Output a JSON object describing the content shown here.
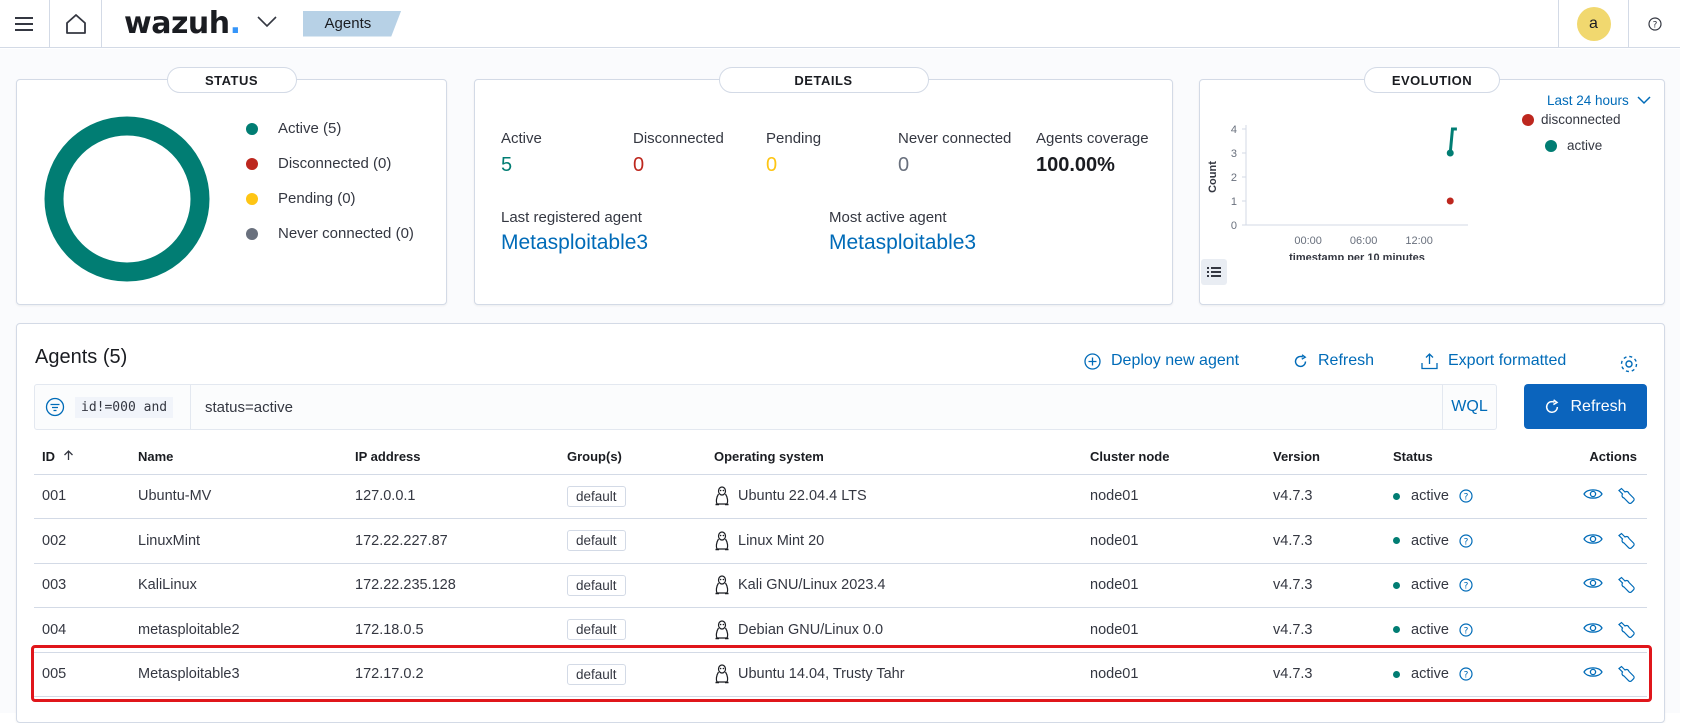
{
  "header": {
    "logo_text": "wazuh",
    "logo_dot": ".",
    "breadcrumb": "Agents",
    "avatar_letter": "a"
  },
  "status_panel": {
    "title": "STATUS",
    "legend": [
      {
        "label": "Active (5)",
        "color": "#017d73"
      },
      {
        "label": "Disconnected (0)",
        "color": "#bd271e"
      },
      {
        "label": "Pending (0)",
        "color": "#fec514"
      },
      {
        "label": "Never connected (0)",
        "color": "#69707d"
      }
    ],
    "donut_color": "#017d73"
  },
  "details_panel": {
    "title": "DETAILS",
    "stats": [
      {
        "label": "Active",
        "value": "5",
        "color": "#017d73"
      },
      {
        "label": "Disconnected",
        "value": "0",
        "color": "#bd271e"
      },
      {
        "label": "Pending",
        "value": "0",
        "color": "#fec514"
      },
      {
        "label": "Never connected",
        "value": "0",
        "color": "#69707d"
      },
      {
        "label": "Agents coverage",
        "value": "100.00%",
        "color": "#1a1c21"
      }
    ],
    "last_registered_label": "Last registered agent",
    "last_registered_value": "Metasploitable3",
    "most_active_label": "Most active agent",
    "most_active_value": "Metasploitable3"
  },
  "evolution_panel": {
    "title": "EVOLUTION",
    "range_label": "Last 24 hours",
    "legend": [
      {
        "label": "disconnected",
        "color": "#bd271e"
      },
      {
        "label": "active",
        "color": "#017d73"
      }
    ],
    "chart_data": {
      "type": "line",
      "ylabel": "Count",
      "xlabel": "timestamp per 10 minutes",
      "y_ticks": [
        "0",
        "1",
        "2",
        "3",
        "4"
      ],
      "x_ticks": [
        "00:00",
        "06:00",
        "12:00"
      ],
      "ylim": [
        0,
        4
      ],
      "series": [
        {
          "name": "active",
          "color": "#017d73",
          "points": [
            [
              0.92,
              3
            ],
            [
              0.95,
              4
            ]
          ]
        },
        {
          "name": "disconnected",
          "color": "#bd271e",
          "points": [
            [
              0.92,
              1
            ]
          ]
        }
      ]
    }
  },
  "agents_section": {
    "title": "Agents (5)",
    "deploy_label": "Deploy new agent",
    "refresh_link_label": "Refresh",
    "export_label": "Export formatted",
    "filter_chip": "id!=000 and",
    "query": "status=active",
    "wql_label": "WQL",
    "refresh_button_label": "Refresh",
    "columns": [
      "ID",
      "Name",
      "IP address",
      "Group(s)",
      "Operating system",
      "Cluster node",
      "Version",
      "Status",
      "Actions"
    ],
    "rows": [
      {
        "id": "001",
        "name": "Ubuntu-MV",
        "ip": "127.0.0.1",
        "group": "default",
        "os": "Ubuntu 22.04.4 LTS",
        "node": "node01",
        "version": "v4.7.3",
        "status": "active"
      },
      {
        "id": "002",
        "name": "LinuxMint",
        "ip": "172.22.227.87",
        "group": "default",
        "os": "Linux Mint 20",
        "node": "node01",
        "version": "v4.7.3",
        "status": "active"
      },
      {
        "id": "003",
        "name": "KaliLinux",
        "ip": "172.22.235.128",
        "group": "default",
        "os": "Kali GNU/Linux 2023.4",
        "node": "node01",
        "version": "v4.7.3",
        "status": "active"
      },
      {
        "id": "004",
        "name": "metasploitable2",
        "ip": "172.18.0.5",
        "group": "default",
        "os": "Debian GNU/Linux 0.0",
        "node": "node01",
        "version": "v4.7.3",
        "status": "active"
      },
      {
        "id": "005",
        "name": "Metasploitable3",
        "ip": "172.17.0.2",
        "group": "default",
        "os": "Ubuntu 14.04, Trusty Tahr",
        "node": "node01",
        "version": "v4.7.3",
        "status": "active"
      }
    ]
  }
}
